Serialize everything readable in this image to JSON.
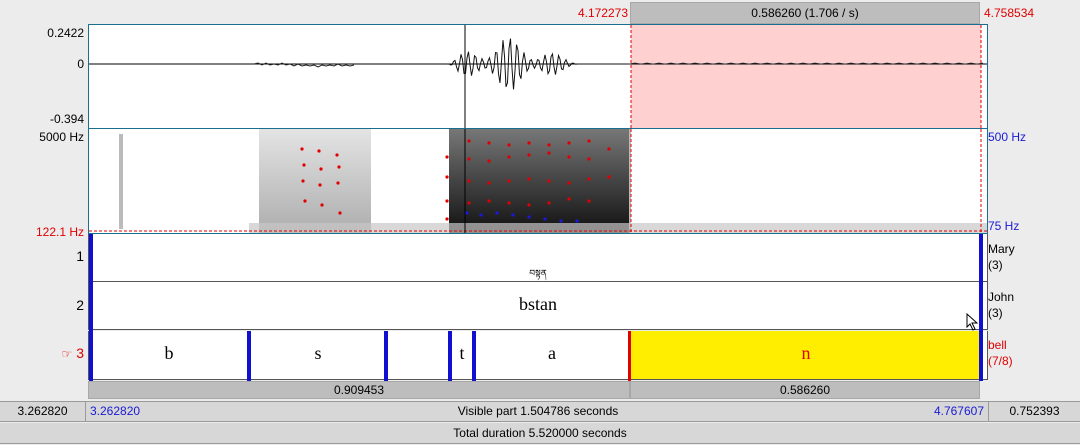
{
  "selection": {
    "start_time": "4.172273",
    "end_time": "4.758534",
    "duration_label": "0.586260 (1.706 / s)"
  },
  "waveform": {
    "max_label": "0.2422",
    "zero_label": "0",
    "min_label": "-0.394"
  },
  "spectrogram": {
    "top_freq_label": "5000 Hz",
    "bottom_freq_label": "122.1 Hz",
    "pitch_top_label": "500 Hz",
    "pitch_bottom_label": "75 Hz"
  },
  "tiers": [
    {
      "number": "1",
      "name": "Mary",
      "count": "(3)",
      "text": "བསྟན"
    },
    {
      "number": "2",
      "name": "John",
      "count": "(3)",
      "text": "bstan"
    },
    {
      "number": "3",
      "marker": "☞",
      "name": "bell",
      "count": "(7/8)",
      "intervals": [
        "b",
        "s",
        "t",
        "a",
        "n"
      ]
    }
  ],
  "bottom_segments": {
    "left": "0.909453",
    "right": "0.586260"
  },
  "visible_row": {
    "window_start": "3.262820",
    "visible_start": "3.262820",
    "visible_label": "Visible part 1.504786 seconds",
    "visible_end": "4.767607",
    "window_end": "0.752393"
  },
  "total_label": "Total duration 5.520000 seconds",
  "colors": {
    "selection_fill": "#ffd0d0",
    "interval_highlight": "#ffee00",
    "boundary": "#1010d0",
    "red_text": "#e00000",
    "blue_text": "#1a1ad6"
  },
  "icons": {
    "pointer": "hand-pointer-icon",
    "cursor": "mouse-cursor-icon"
  }
}
